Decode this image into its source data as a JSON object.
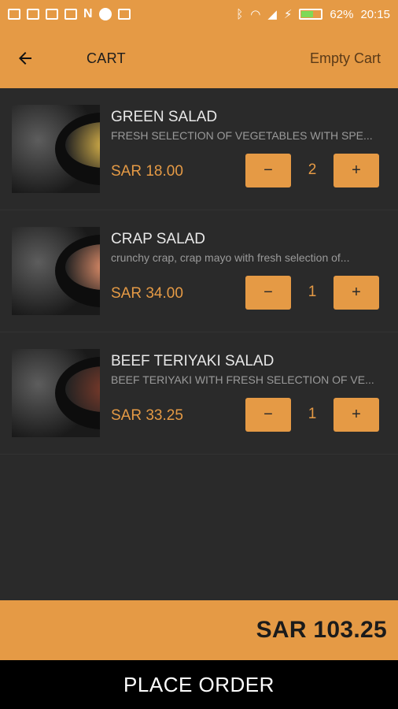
{
  "status_bar": {
    "battery": "62%",
    "time": "20:15",
    "notif_letter": "N",
    "battery_level_fraction": 0.62
  },
  "app_bar": {
    "title": "CART",
    "action_label": "Empty Cart",
    "back_icon": "arrow-left-icon"
  },
  "cart": {
    "items": [
      {
        "name": "GREEN SALAD",
        "description": "FRESH SELECTION OF VEGETABLES WITH SPE...",
        "price": "SAR 18.00",
        "quantity": "2",
        "minus_label": "−",
        "plus_label": "+",
        "food_color": "#d9b34a"
      },
      {
        "name": "CRAP SALAD",
        "description": "crunchy crap, crap mayo with fresh selection of...",
        "price": "SAR 34.00",
        "quantity": "1",
        "minus_label": "−",
        "plus_label": "+",
        "food_color": "#e08e6a"
      },
      {
        "name": "BEEF TERIYAKI SALAD",
        "description": "BEEF TERIYAKI WITH FRESH SELECTION OF VE...",
        "price": "SAR 33.25",
        "quantity": "1",
        "minus_label": "−",
        "plus_label": "+",
        "food_color": "#7a3a2a"
      }
    ],
    "total": "SAR 103.25"
  },
  "footer": {
    "place_order_label": "PLACE ORDER"
  },
  "colors": {
    "accent": "#e59a45",
    "background": "#2a2a2a",
    "button_bar": "#000000"
  }
}
